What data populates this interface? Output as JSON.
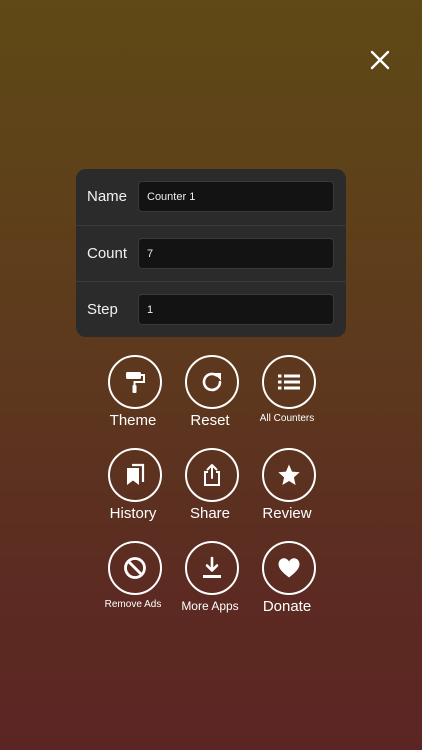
{
  "header": {
    "close_icon": "close-icon"
  },
  "settings": {
    "name_label": "Name",
    "name_value": "Counter 1",
    "count_label": "Count",
    "count_value": "7",
    "step_label": "Step",
    "step_value": "1"
  },
  "actions": {
    "theme": {
      "label": "Theme",
      "icon": "paint-roller-icon"
    },
    "reset": {
      "label": "Reset",
      "icon": "refresh-icon"
    },
    "all_counters": {
      "label": "All Counters",
      "icon": "list-icon"
    },
    "history": {
      "label": "History",
      "icon": "bookmarks-icon"
    },
    "share": {
      "label": "Share",
      "icon": "share-icon"
    },
    "review": {
      "label": "Review",
      "icon": "star-icon"
    },
    "remove_ads": {
      "label": "Remove Ads",
      "icon": "ban-icon"
    },
    "more_apps": {
      "label": "More Apps",
      "icon": "download-icon"
    },
    "donate": {
      "label": "Donate",
      "icon": "heart-icon"
    }
  },
  "colors": {
    "gradient_top": "#5f4915",
    "gradient_bottom": "#5b2523",
    "card": "#2b2b2b",
    "input": "#131313"
  }
}
